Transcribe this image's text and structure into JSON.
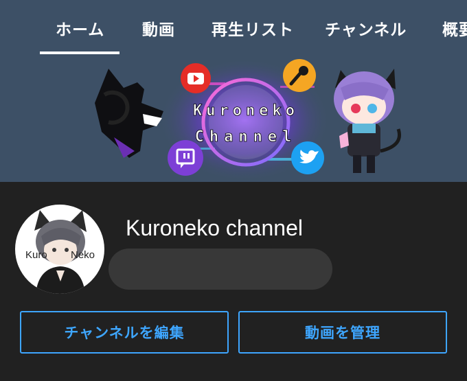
{
  "tabs": [
    {
      "label": "ホーム",
      "selected": true
    },
    {
      "label": "動画",
      "selected": false
    },
    {
      "label": "再生リスト",
      "selected": false
    },
    {
      "label": "チャンネル",
      "selected": false
    },
    {
      "label": "概要",
      "selected": false
    }
  ],
  "banner": {
    "line1": "Kuroneko",
    "line2": "Channel",
    "icons": [
      "youtube-icon",
      "microphone-icon",
      "twitch-icon",
      "twitter-icon"
    ]
  },
  "avatar": {
    "left_text": "Kuro",
    "right_text": "Neko"
  },
  "channel": {
    "name": "Kuroneko channel"
  },
  "actions": {
    "edit_channel": "チャンネルを編集",
    "manage_videos": "動画を管理"
  },
  "colors": {
    "header_bg": "#3d5066",
    "page_bg": "#212121",
    "accent": "#3ea6ff",
    "pill": "#383838"
  }
}
